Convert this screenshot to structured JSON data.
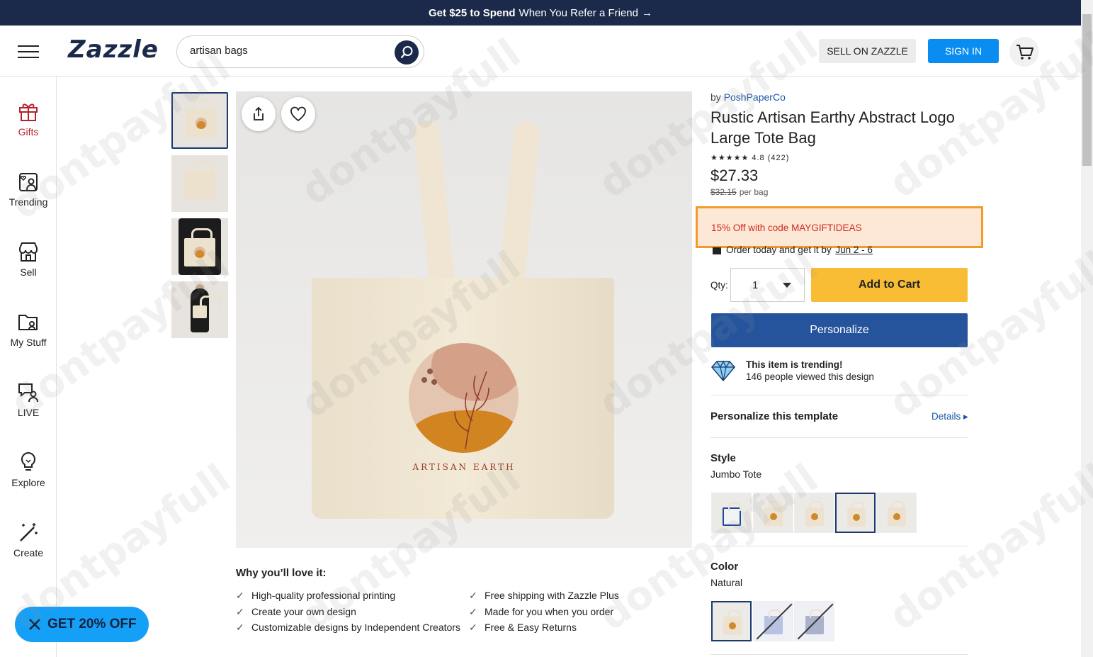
{
  "topbar": {
    "bold": "Get $25 to Spend",
    "text": "When You Refer a Friend",
    "arrow": "→"
  },
  "header": {
    "logo": "Zazzle",
    "search_value": "artisan bags",
    "sell_label": "SELL ON ZAZZLE",
    "signin_label": "SIGN IN"
  },
  "sidenav": [
    {
      "label": "Gifts",
      "icon": "gift-icon"
    },
    {
      "label": "Trending",
      "icon": "trending-icon"
    },
    {
      "label": "Sell",
      "icon": "store-icon"
    },
    {
      "label": "My Stuff",
      "icon": "folder-icon"
    },
    {
      "label": "LIVE",
      "icon": "live-chat-icon"
    },
    {
      "label": "Explore",
      "icon": "lightbulb-icon"
    },
    {
      "label": "Create",
      "icon": "magic-wand-icon"
    }
  ],
  "product": {
    "by_prefix": "by",
    "brand": "PoshPaperCo",
    "title": "Rustic Artisan Earthy Abstract Logo Large Tote Bag",
    "rating_stars": "★★★★★",
    "rating": "4.8 (422)",
    "price": "$27.33",
    "old_price": "$32.15",
    "per": "per bag",
    "promo": "15% Off with code MAYGIFTIDEAS",
    "delivery_prefix": "Order today and get it by",
    "delivery_date": "Jun 2 - 6",
    "qty_label": "Qty:",
    "qty_value": "1",
    "add_to_cart": "Add to Cart",
    "personalize": "Personalize",
    "trending_title": "This item is trending!",
    "trending_text": "146 people viewed this design",
    "personalize_template": "Personalize this template",
    "details_link": "Details ▸",
    "style_title": "Style",
    "style_value": "Jumbo Tote",
    "color_title": "Color",
    "color_value": "Natural",
    "image_text": "ARTISAN EARTH"
  },
  "love": {
    "title": "Why you’ll love it:",
    "left": [
      "High-quality professional printing",
      "Create your own design",
      "Customizable designs by Independent Creators"
    ],
    "right": [
      "Free shipping with Zazzle Plus",
      "Made for you when you order",
      "Free & Easy Returns"
    ]
  },
  "popup": {
    "label": "GET 20% OFF"
  },
  "watermark": "dontpayfull",
  "colors": {
    "navy": "#1b2a4a",
    "blue": "#0a8df0",
    "cta_yellow": "#f8bd35",
    "personalize_blue": "#25549d",
    "promo_border": "#f39a2b",
    "promo_text": "#d22c1c"
  }
}
